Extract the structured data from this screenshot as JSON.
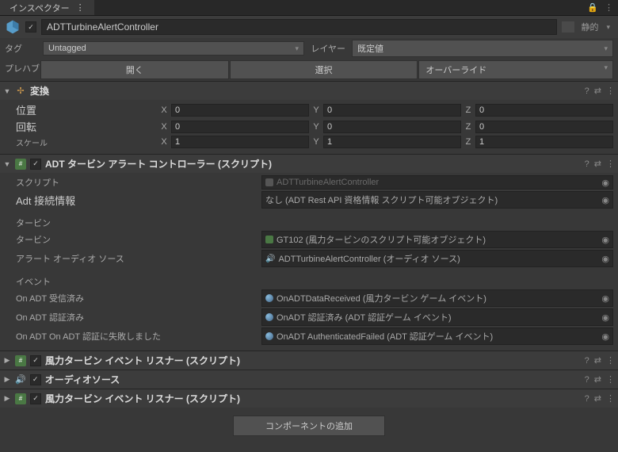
{
  "tab": {
    "title": "インスペクター"
  },
  "header": {
    "name": "ADTTurbineAlertController",
    "static_label": "静的"
  },
  "tag": {
    "label": "タグ",
    "value": "Untagged"
  },
  "layer": {
    "label": "レイヤー",
    "value": "既定値"
  },
  "prefab": {
    "label": "プレハブ",
    "open": "開く",
    "select": "選択",
    "overrides": "オーバーライド"
  },
  "transform": {
    "title": "変換",
    "position": {
      "label": "位置",
      "x": "0",
      "y": "0",
      "z": "0"
    },
    "rotation": {
      "label": "回転",
      "x": "0",
      "y": "0",
      "z": "0"
    },
    "scale": {
      "label": "スケール",
      "x": "1",
      "y": "1",
      "z": "1"
    }
  },
  "script1": {
    "title": "ADT タービン アラート コントローラー (スクリプト)",
    "script_label": "スクリプト",
    "script_value": "ADTTurbineAlertController",
    "conn_label": "Adt 接続情報",
    "conn_value": "なし (ADT Rest API 資格情報 スクリプト可能オブジェクト)",
    "turbine_header": "タービン",
    "turbine_label": "タービン",
    "turbine_value": "GT102 (風力タービンのスクリプト可能オブジェクト)",
    "audio_label": "アラート オーディオ ソース",
    "audio_value": "ADTTurbineAlertController (オーディオ ソース)",
    "events_header": "イベント",
    "ev1_label": "On ADT 受信済み",
    "ev1_value": "OnADTDataReceived (風力タービン ゲーム イベント)",
    "ev2_label": "On ADT 認証済み",
    "ev2_value": "OnADT 認証済み (ADT 認証ゲーム イベント)",
    "ev3_label": "On ADT On ADT 認証に失敗しました",
    "ev3_value": "OnADT AuthenticatedFailed (ADT 認証ゲーム イベント)"
  },
  "collapsed": {
    "c1": "風力タービン イベント リスナー (スクリプト)",
    "c2": "オーディオソース",
    "c3": "風力タービン イベント リスナー (スクリプト)"
  },
  "add_component": "コンポーネントの追加"
}
